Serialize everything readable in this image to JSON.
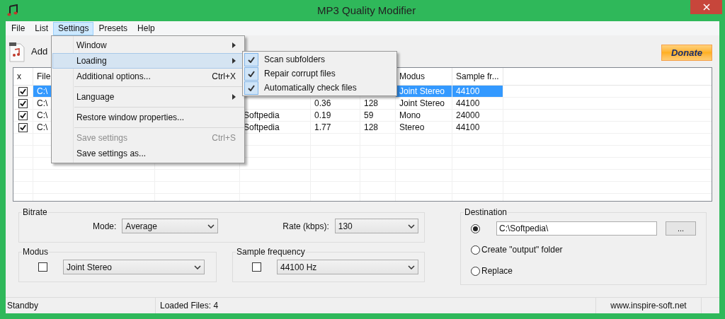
{
  "window": {
    "title": "MP3 Quality Modifier"
  },
  "menu_bar": [
    {
      "label": "File",
      "selected": false
    },
    {
      "label": "List",
      "selected": false
    },
    {
      "label": "Settings",
      "selected": true
    },
    {
      "label": "Presets",
      "selected": false
    },
    {
      "label": "Help",
      "selected": false
    }
  ],
  "settings_menu": [
    {
      "kind": "item",
      "label": "Window",
      "submenu": true,
      "selected": false,
      "disabled": false
    },
    {
      "kind": "item",
      "label": "Loading",
      "submenu": true,
      "selected": true,
      "disabled": false
    },
    {
      "kind": "item",
      "label": "Additional options...",
      "shortcut": "Ctrl+X",
      "submenu": false,
      "selected": false,
      "disabled": false
    },
    {
      "kind": "separator"
    },
    {
      "kind": "item",
      "label": "Language",
      "submenu": true,
      "selected": false,
      "disabled": false
    },
    {
      "kind": "separator"
    },
    {
      "kind": "item",
      "label": "Restore window properties...",
      "submenu": false,
      "selected": false,
      "disabled": false
    },
    {
      "kind": "separator"
    },
    {
      "kind": "item",
      "label": "Save settings",
      "shortcut": "Ctrl+S",
      "submenu": false,
      "selected": false,
      "disabled": true
    },
    {
      "kind": "item",
      "label": "Save settings as...",
      "submenu": false,
      "selected": false,
      "disabled": false
    }
  ],
  "loading_submenu": [
    {
      "label": "Scan subfolders",
      "checked": true
    },
    {
      "label": "Repair corrupt files",
      "checked": true
    },
    {
      "label": "Automatically check files",
      "checked": true
    }
  ],
  "toolbar": {
    "add": "Add",
    "donate": "Donate"
  },
  "table": {
    "check_column": "x",
    "columns": [
      "File",
      null,
      null,
      null,
      null,
      "Modus",
      "Sample fr..."
    ],
    "rows": [
      {
        "checked": true,
        "selected": true,
        "cells": [
          "C:\\",
          null,
          null,
          null,
          null,
          "Joint Stereo",
          "44100"
        ]
      },
      {
        "checked": true,
        "selected": false,
        "cells": [
          "C:\\",
          null,
          null,
          "0.36",
          "128",
          "Joint Stereo",
          "44100"
        ]
      },
      {
        "checked": true,
        "selected": false,
        "cells": [
          "C:\\",
          null,
          "Softpedia",
          "0.19",
          "59",
          "Mono",
          "24000"
        ]
      },
      {
        "checked": true,
        "selected": false,
        "cells": [
          "C:\\",
          null,
          "Softpedia",
          "1.77",
          "128",
          "Stereo",
          "44100"
        ]
      }
    ]
  },
  "bitrate": {
    "title": "Bitrate",
    "mode_label": "Mode:",
    "mode": "Average",
    "rate_label": "Rate (kbps):",
    "rate": "130"
  },
  "modus": {
    "title": "Modus",
    "checked": false,
    "value": "Joint Stereo"
  },
  "sample_frequency": {
    "title": "Sample frequency",
    "checked": false,
    "value": "44100 Hz"
  },
  "destination": {
    "title": "Destination",
    "options": [
      {
        "kind": "path",
        "value": "C:\\Softpedia\\",
        "browse": "...",
        "selected": true
      },
      {
        "kind": "label",
        "label": "Create \"output\" folder",
        "selected": false
      },
      {
        "kind": "label",
        "label": "Replace",
        "selected": false
      }
    ]
  },
  "status_bar": {
    "status": "Standby",
    "loaded": "Loaded Files: 4",
    "website": "www.inspire-soft.net"
  }
}
